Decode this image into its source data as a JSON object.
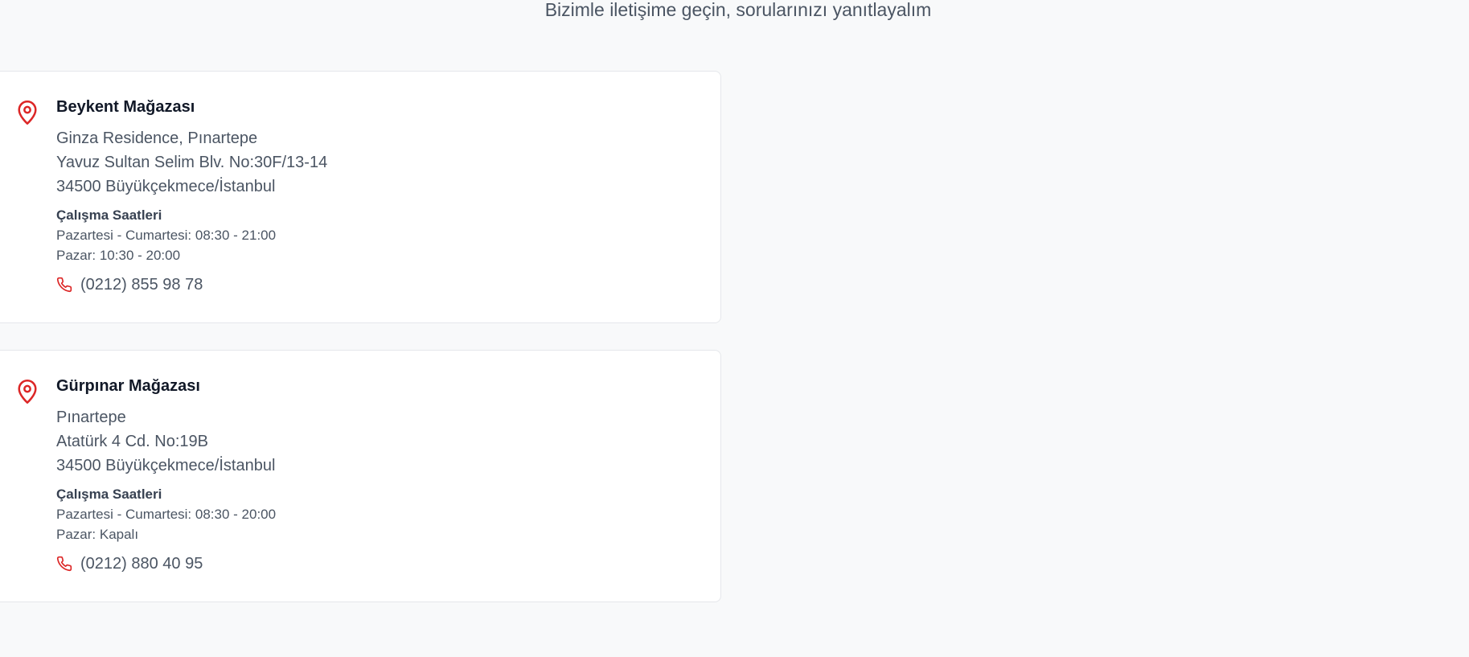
{
  "page": {
    "subtitle": "Bizimle iletişime geçin, sorularınızı yanıtlayalım"
  },
  "colors": {
    "accent": "#dc2626",
    "background": "#f8f9fa",
    "card": "#ffffff"
  },
  "icons": {
    "location": "map-pin-icon",
    "phone": "phone-icon"
  },
  "stores": [
    {
      "name": "Beykent Mağazası",
      "address": [
        "Ginza Residence, Pınartepe",
        "Yavuz Sultan Selim Blv. No:30F/13-14",
        "34500 Büyükçekmece/İstanbul"
      ],
      "hours_title": "Çalışma Saatleri",
      "hours": [
        "Pazartesi - Cumartesi: 08:30 - 21:00",
        "Pazar: 10:30 - 20:00"
      ],
      "phone": "(0212) 855 98 78"
    },
    {
      "name": "Gürpınar Mağazası",
      "address": [
        "Pınartepe",
        "Atatürk 4 Cd. No:19B",
        "34500 Büyükçekmece/İstanbul"
      ],
      "hours_title": "Çalışma Saatleri",
      "hours": [
        "Pazartesi - Cumartesi: 08:30 - 20:00",
        "Pazar: Kapalı"
      ],
      "phone": "(0212) 880 40 95"
    }
  ]
}
